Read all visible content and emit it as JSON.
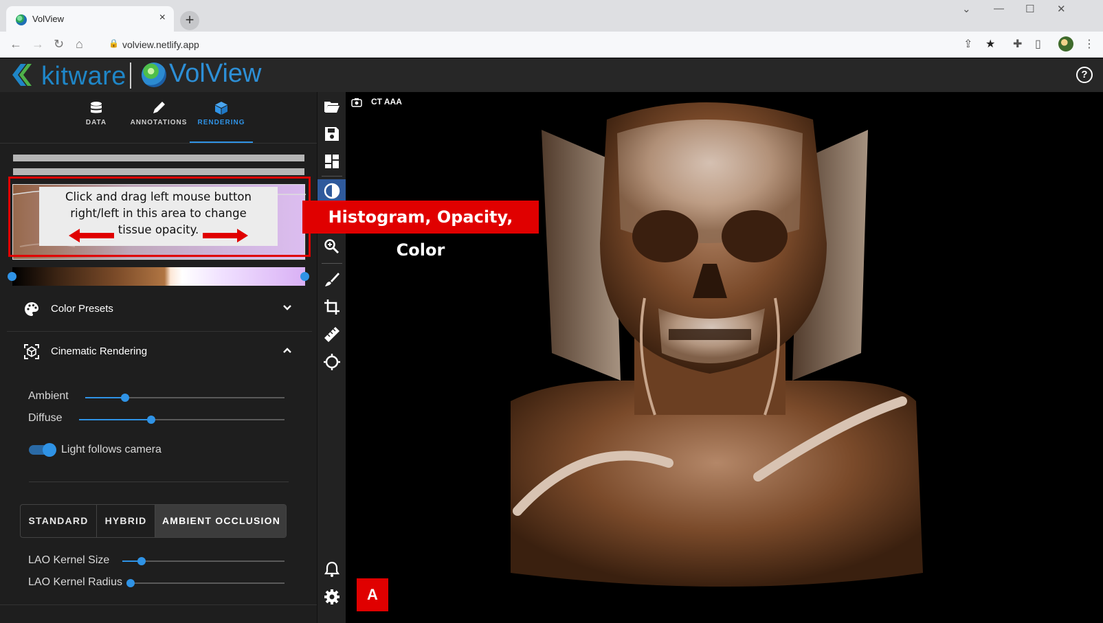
{
  "browser": {
    "tab_title": "VolView",
    "url": "volview.netlify.app"
  },
  "header": {
    "brand1": "kitware",
    "brand2": "VolView",
    "help_label": "?"
  },
  "tabs": [
    {
      "label": "DATA",
      "icon": "database-icon"
    },
    {
      "label": "ANNOTATIONS",
      "icon": "pencil-icon"
    },
    {
      "label": "RENDERING",
      "icon": "cube-icon",
      "active": true
    }
  ],
  "histogram_tip": {
    "line1": "Click and drag left mouse button",
    "line2": "right/left in this area to change",
    "line3": "tissue opacity."
  },
  "sections": {
    "color_presets": "Color Presets",
    "cinematic": "Cinematic Rendering"
  },
  "sliders": {
    "ambient": {
      "label": "Ambient",
      "value": 0.2
    },
    "diffuse": {
      "label": "Diffuse",
      "value": 0.35
    },
    "lao_size": {
      "label": "LAO Kernel Size",
      "value": 0.12
    },
    "lao_radius": {
      "label": "LAO Kernel Radius",
      "value": 0.0
    }
  },
  "toggle": {
    "label": "Light follows camera",
    "on": true
  },
  "modes": [
    {
      "label": "STANDARD"
    },
    {
      "label": "HYBRID"
    },
    {
      "label": "AMBIENT OCCLUSION",
      "active": true
    }
  ],
  "viewport": {
    "label": "CT AAA"
  },
  "annotations": {
    "histogram_label": "Histogram, Opacity, Color",
    "panel_badge": "A"
  },
  "colors": {
    "accent": "#2f93e6",
    "callout": "#e00000",
    "panel": "#1e1e1e"
  }
}
